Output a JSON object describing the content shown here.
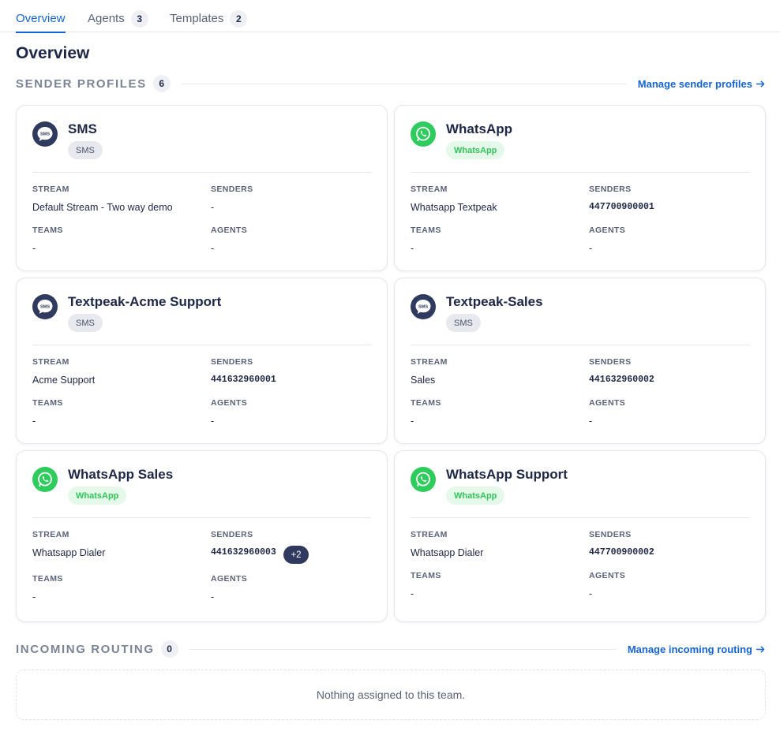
{
  "tabs": [
    {
      "label": "Overview",
      "count": null
    },
    {
      "label": "Agents",
      "count": "3"
    },
    {
      "label": "Templates",
      "count": "2"
    }
  ],
  "page_title": "Overview",
  "sender_profiles": {
    "label": "SENDER PROFILES",
    "count": "6",
    "link": "Manage sender profiles"
  },
  "field_labels": {
    "stream": "STREAM",
    "senders": "SENDERS",
    "teams": "TEAMS",
    "agents": "AGENTS"
  },
  "cards": [
    {
      "icon": "sms-chat-icon",
      "title": "SMS",
      "badge": "SMS",
      "stream": "Default Stream - Two way demo",
      "senders": "-",
      "teams": "-",
      "agents": "-"
    },
    {
      "icon": "whatsapp-icon",
      "title": "WhatsApp",
      "badge": "WhatsApp",
      "stream": "Whatsapp Textpeak",
      "senders": "447700900001",
      "teams": "-",
      "agents": "-"
    },
    {
      "icon": "sms-chat-icon",
      "title": "Textpeak-Acme Support",
      "badge": "SMS",
      "stream": "Acme Support",
      "senders": "441632960001",
      "teams": "-",
      "agents": "-"
    },
    {
      "icon": "sms-chat-icon",
      "title": "Textpeak-Sales",
      "badge": "SMS",
      "stream": "Sales",
      "senders": "441632960002",
      "teams": "-",
      "agents": "-"
    },
    {
      "icon": "whatsapp-icon",
      "title": "WhatsApp Sales",
      "badge": "WhatsApp",
      "stream": "Whatsapp Dialer",
      "senders": "441632960003",
      "senders_more": "+2",
      "teams": "-",
      "agents": "-"
    },
    {
      "icon": "whatsapp-icon",
      "title": "WhatsApp Support",
      "badge": "WhatsApp",
      "stream": "Whatsapp Dialer",
      "senders": "447700900002",
      "teams": "-",
      "agents": "-"
    }
  ],
  "incoming_routing": {
    "label": "INCOMING ROUTING",
    "count": "0",
    "link": "Manage incoming routing",
    "empty_text": "Nothing assigned to this team."
  },
  "colors": {
    "accent": "#1565d8",
    "sms_icon": "#2f3a5e",
    "whatsapp_icon": "#2ecc5c"
  }
}
